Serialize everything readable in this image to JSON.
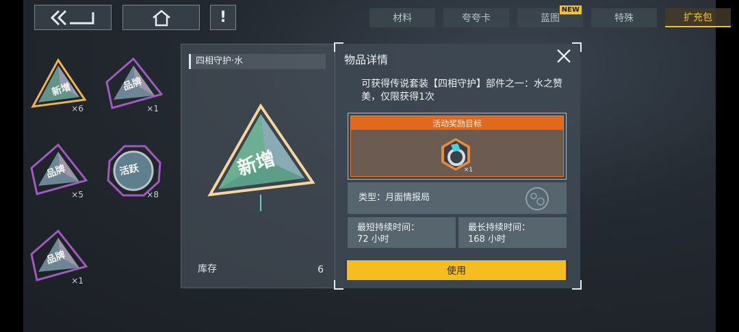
{
  "topbar": {
    "info_label": "!",
    "tabs": [
      {
        "label": "材料",
        "active": false,
        "badge": ""
      },
      {
        "label": "夸夸卡",
        "active": false,
        "badge": ""
      },
      {
        "label": "蓝图",
        "active": false,
        "badge": "NEW"
      },
      {
        "label": "特殊",
        "active": false,
        "badge": ""
      },
      {
        "label": "扩充包",
        "active": true,
        "badge": ""
      }
    ]
  },
  "inventory": [
    {
      "label": "新增",
      "count": "×6",
      "icon": "pyramid-pack-icon",
      "selected": true
    },
    {
      "label": "品牌",
      "count": "×1",
      "icon": "pyramid-pack-icon",
      "selected": false
    },
    {
      "label": "品牌",
      "count": "×5",
      "icon": "pyramid-pack-icon",
      "selected": false
    },
    {
      "label": "活跃",
      "count": "×8",
      "icon": "octagon-pack-icon",
      "selected": false
    },
    {
      "label": "品牌",
      "count": "×1",
      "icon": "pyramid-pack-icon",
      "selected": false
    }
  ],
  "left_panel": {
    "title": "四相守护·水",
    "item_label": "新增",
    "stock_label": "库存",
    "stock_value": "6"
  },
  "detail": {
    "title": "物品详情",
    "description": "可获得传说套装【四相守护】部件之一：水之赞美，仅限获得1次",
    "reward_header": "活动奖励目标",
    "reward_count": "×1",
    "type_text": "类型：月面情报局",
    "min_duration_label": "最短持续时间：",
    "min_duration_value": "72 小时",
    "max_duration_label": "最长持续时间：",
    "max_duration_value": "168 小时",
    "use_label": "使用"
  },
  "colors": {
    "accent": "#f5bd1f",
    "reward_header": "#e0691e",
    "active_tab": "#f2c230"
  }
}
